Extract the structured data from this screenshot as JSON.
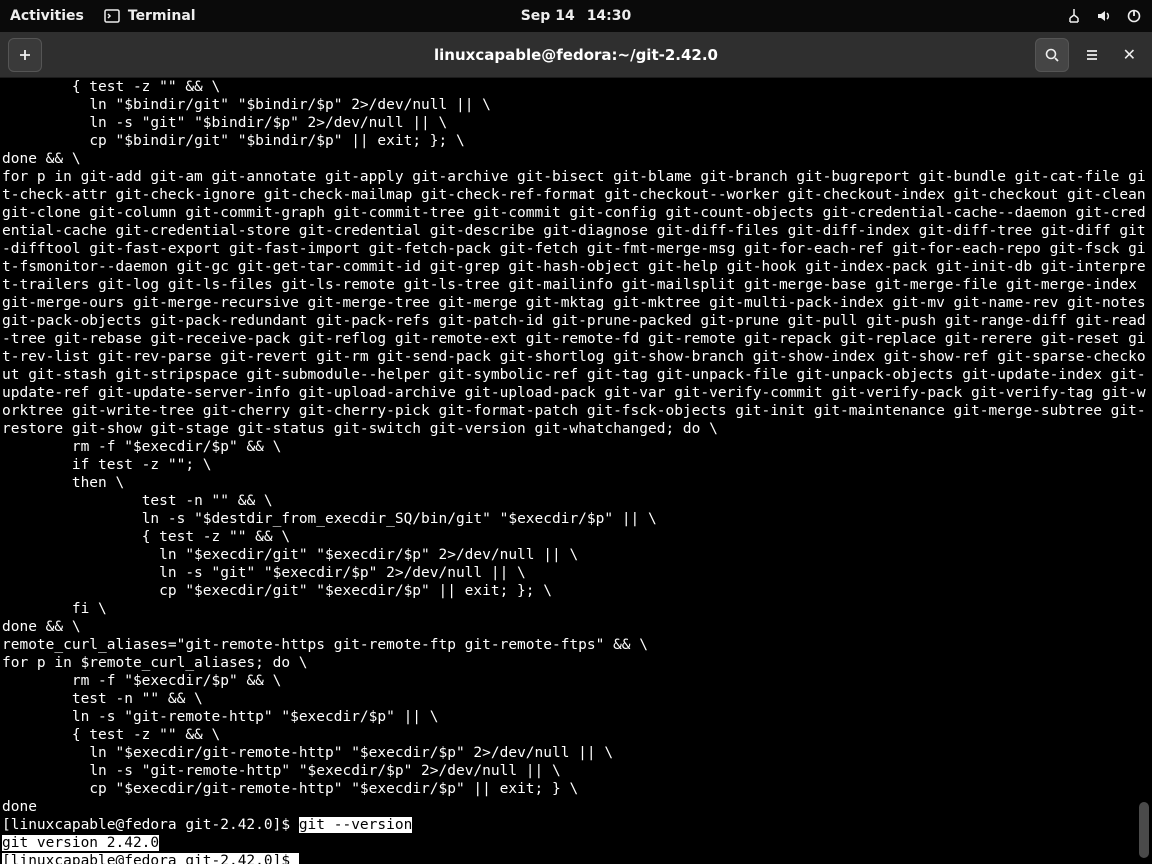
{
  "topbar": {
    "activities": "Activities",
    "app_name": "Terminal",
    "date": "Sep 14",
    "time": "14:30"
  },
  "window": {
    "title": "linuxcapable@fedora:~/git-2.42.0"
  },
  "terminal": {
    "body": "        { test -z \"\" && \\\n          ln \"$bindir/git\" \"$bindir/$p\" 2>/dev/null || \\\n          ln -s \"git\" \"$bindir/$p\" 2>/dev/null || \\\n          cp \"$bindir/git\" \"$bindir/$p\" || exit; }; \\\ndone && \\\nfor p in git-add git-am git-annotate git-apply git-archive git-bisect git-blame git-branch git-bugreport git-bundle git-cat-file git-check-attr git-check-ignore git-check-mailmap git-check-ref-format git-checkout--worker git-checkout-index git-checkout git-clean git-clone git-column git-commit-graph git-commit-tree git-commit git-config git-count-objects git-credential-cache--daemon git-credential-cache git-credential-store git-credential git-describe git-diagnose git-diff-files git-diff-index git-diff-tree git-diff git-difftool git-fast-export git-fast-import git-fetch-pack git-fetch git-fmt-merge-msg git-for-each-ref git-for-each-repo git-fsck git-fsmonitor--daemon git-gc git-get-tar-commit-id git-grep git-hash-object git-help git-hook git-index-pack git-init-db git-interpret-trailers git-log git-ls-files git-ls-remote git-ls-tree git-mailinfo git-mailsplit git-merge-base git-merge-file git-merge-index git-merge-ours git-merge-recursive git-merge-tree git-merge git-mktag git-mktree git-multi-pack-index git-mv git-name-rev git-notes git-pack-objects git-pack-redundant git-pack-refs git-patch-id git-prune-packed git-prune git-pull git-push git-range-diff git-read-tree git-rebase git-receive-pack git-reflog git-remote-ext git-remote-fd git-remote git-repack git-replace git-rerere git-reset git-rev-list git-rev-parse git-revert git-rm git-send-pack git-shortlog git-show-branch git-show-index git-show-ref git-sparse-checkout git-stash git-stripspace git-submodule--helper git-symbolic-ref git-tag git-unpack-file git-unpack-objects git-update-index git-update-ref git-update-server-info git-upload-archive git-upload-pack git-var git-verify-commit git-verify-pack git-verify-tag git-worktree git-write-tree git-cherry git-cherry-pick git-format-patch git-fsck-objects git-init git-maintenance git-merge-subtree git-restore git-show git-stage git-status git-switch git-version git-whatchanged; do \\\n        rm -f \"$execdir/$p\" && \\\n        if test -z \"\"; \\\n        then \\\n                test -n \"\" && \\\n                ln -s \"$destdir_from_execdir_SQ/bin/git\" \"$execdir/$p\" || \\\n                { test -z \"\" && \\\n                  ln \"$execdir/git\" \"$execdir/$p\" 2>/dev/null || \\\n                  ln -s \"git\" \"$execdir/$p\" 2>/dev/null || \\\n                  cp \"$execdir/git\" \"$execdir/$p\" || exit; }; \\\n        fi \\\ndone && \\\nremote_curl_aliases=\"git-remote-https git-remote-ftp git-remote-ftps\" && \\\nfor p in $remote_curl_aliases; do \\\n        rm -f \"$execdir/$p\" && \\\n        test -n \"\" && \\\n        ln -s \"git-remote-http\" \"$execdir/$p\" || \\\n        { test -z \"\" && \\\n          ln \"$execdir/git-remote-http\" \"$execdir/$p\" 2>/dev/null || \\\n          ln -s \"git-remote-http\" \"$execdir/$p\" 2>/dev/null || \\\n          cp \"$execdir/git-remote-http\" \"$execdir/$p\" || exit; } \\\ndone",
    "prompt1_prefix": "[linuxcapable@fedora git-2.42.0]$ ",
    "prompt1_cmd": "git --version",
    "version_line": "git version 2.42.0",
    "prompt2_prefix": "[linuxcapable@fedora git-2.42.0]$ ",
    "prompt2_cmd": ""
  }
}
